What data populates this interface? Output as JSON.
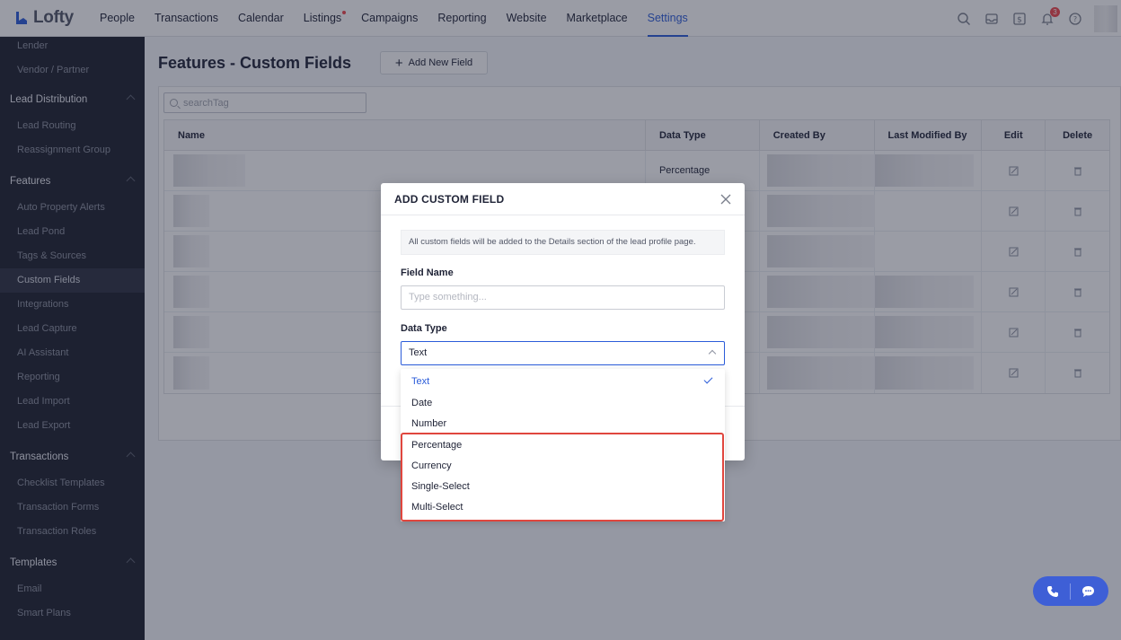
{
  "app": {
    "logo_text": "Lofty"
  },
  "nav": {
    "items": [
      "People",
      "Transactions",
      "Calendar",
      "Listings",
      "Campaigns",
      "Reporting",
      "Website",
      "Marketplace",
      "Settings"
    ],
    "active": "Settings",
    "notification_count": "3"
  },
  "sidebar": {
    "top_items": [
      "Lender",
      "Vendor / Partner"
    ],
    "lead_distribution": {
      "title": "Lead Distribution",
      "items": [
        "Lead Routing",
        "Reassignment Group"
      ]
    },
    "features": {
      "title": "Features",
      "items": [
        "Auto Property Alerts",
        "Lead Pond",
        "Tags & Sources",
        "Custom Fields",
        "Integrations",
        "Lead Capture",
        "AI Assistant",
        "Reporting",
        "Lead Import",
        "Lead Export"
      ]
    },
    "transactions": {
      "title": "Transactions",
      "items": [
        "Checklist Templates",
        "Transaction Forms",
        "Transaction Roles"
      ]
    },
    "templates": {
      "title": "Templates",
      "items": [
        "Email",
        "Smart Plans"
      ]
    },
    "active_item": "Custom Fields"
  },
  "page": {
    "title": "Features - Custom Fields",
    "add_button": "Add New Field",
    "search_placeholder": "searchTag"
  },
  "table": {
    "headers": {
      "name": "Name",
      "data_type": "Data Type",
      "created_by": "Created By",
      "last_modified_by": "Last Modified By",
      "edit": "Edit",
      "delete": "Delete"
    },
    "first_row_type": "Percentage"
  },
  "modal": {
    "title": "ADD CUSTOM FIELD",
    "info": "All custom fields will be added to the Details section of the lead profile page.",
    "field_name_label": "Field Name",
    "field_name_placeholder": "Type something...",
    "data_type_label": "Data Type",
    "data_type_value": "Text",
    "options": [
      "Text",
      "Date",
      "Number",
      "Percentage",
      "Currency",
      "Single-Select",
      "Multi-Select"
    ]
  },
  "colors": {
    "accent": "#2b5cd9",
    "highlight": "#e0463e",
    "sidebar": "#1c1f2c"
  },
  "icons": [
    "search-icon",
    "inbox-icon",
    "dollar-icon",
    "bell-icon",
    "help-icon",
    "edit-icon",
    "trash-icon",
    "close-icon",
    "phone-icon",
    "chat-icon"
  ]
}
